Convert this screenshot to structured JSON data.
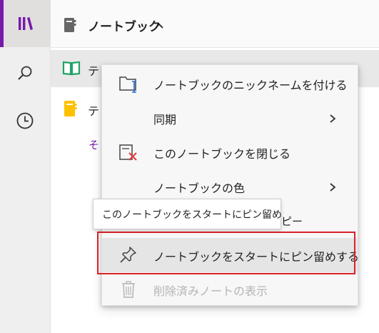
{
  "header": {
    "title": "ノートブック"
  },
  "notebooks": [
    {
      "label": "テ"
    },
    {
      "label": "テ"
    }
  ],
  "more_link": "そ",
  "context_menu": {
    "items": [
      {
        "label": "ノートブックのニックネームを付ける",
        "icon": "folder-rename-icon",
        "submenu": false,
        "disabled": false
      },
      {
        "label": "同期",
        "icon": "",
        "submenu": true,
        "disabled": false
      },
      {
        "label": "このノートブックを閉じる",
        "icon": "close-notebook-icon",
        "submenu": false,
        "disabled": false
      },
      {
        "label": "ノートブックの色",
        "icon": "",
        "submenu": true,
        "disabled": false
      },
      {
        "label": "ピー",
        "icon": "",
        "submenu": false,
        "disabled": false
      },
      {
        "label": "ノートブックをスタートにピン留めする",
        "icon": "pin-icon",
        "submenu": false,
        "disabled": false
      },
      {
        "label": "削除済みノートの表示",
        "icon": "trash-icon",
        "submenu": false,
        "disabled": true
      }
    ]
  },
  "tooltip": {
    "text": "このノートブックをスタートにピン留め"
  },
  "colors": {
    "accent": "#7719aa",
    "notebook_green": "#21a366",
    "notebook_yellow": "#ffc000",
    "highlight_red": "#d9212a"
  }
}
